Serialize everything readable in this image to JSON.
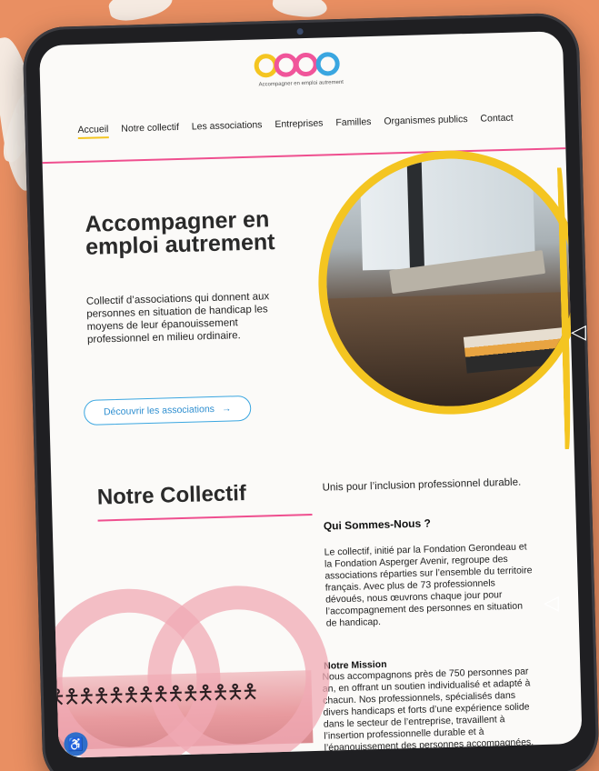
{
  "logo": {
    "tagline": "Accompagner en emploi autrement"
  },
  "nav": {
    "items": [
      {
        "label": "Accueil",
        "active": true
      },
      {
        "label": "Notre collectif"
      },
      {
        "label": "Les associations"
      },
      {
        "label": "Entreprises"
      },
      {
        "label": "Familles"
      },
      {
        "label": "Organismes publics"
      },
      {
        "label": "Contact"
      }
    ]
  },
  "hero": {
    "title": "Accompagner en emploi autrement",
    "text": "Collectif d’associations qui donnent aux personnes en situation de handicap les moyens de leur épanouissement professionnel en milieu ordinaire.",
    "cta": "Découvrir les associations",
    "cta_icon": "arrow-right-icon"
  },
  "collectif": {
    "title": "Notre Collectif",
    "subtitle": "Unis pour l’inclusion professionnel durable.",
    "heading": "Qui Sommes-Nous ?",
    "paragraph": "Le collectif, initié par la Fondation Gerondeau et la Fondation Asperger Avenir, regroupe des associations réparties sur l’ensemble du territoire français. Avec plus de 73 professionnels dévoués, nous œuvrons chaque jour pour l’accompagnement des personnes en situation de handicap.",
    "mission_heading": "Notre Mission",
    "mission_text": "Nous accompagnons près de 750 personnes par an, en offrant un soutien individualisé et adapté à chacun. Nos professionnels, spécialisés dans divers handicaps et forts d’une expérience solide dans le secteur de l’entreprise, travaillent à l’insertion professionnelle durable et à l’épanouissement des personnes accompagnées."
  },
  "colors": {
    "yellow": "#f4c521",
    "pink": "#ef4f8f",
    "blue": "#3aa6e0",
    "background": "#e98f62"
  },
  "accessibility_button_icon": "accessibility-icon"
}
